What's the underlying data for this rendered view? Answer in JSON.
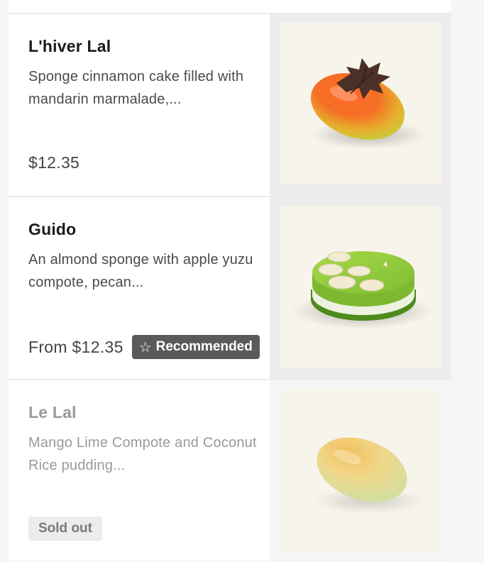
{
  "items": [
    {
      "name": "L'hiver Lal",
      "description": "Sponge cinnamon cake filled with mandarin marmalade,...",
      "price": "$12.35",
      "image_icon": "mandarin-cake-photo"
    },
    {
      "name": "Guido",
      "description": "An almond sponge with apple yuzu compote, pecan...",
      "price": "From $12.35",
      "badge": "Recommended",
      "badge_icon": "star-outline",
      "image_icon": "green-round-cake-photo"
    },
    {
      "name": "Le Lal",
      "description": "Mango Lime Compote and Coconut Rice pudding...",
      "status": "Sold out",
      "image_icon": "mango-cake-photo"
    }
  ],
  "colors": {
    "badge_bg": "#5a5a5a",
    "sold_out_text": "#9a9a9a",
    "photo_bg": "#f7f4ec"
  }
}
